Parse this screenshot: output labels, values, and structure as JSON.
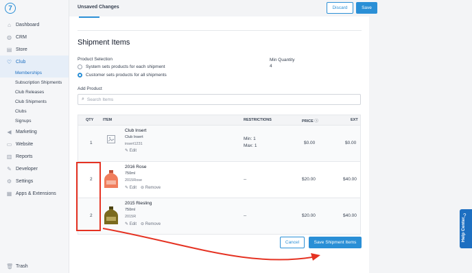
{
  "topbar": {
    "title": "Unsaved Changes",
    "discard_label": "Discard",
    "save_label": "Save"
  },
  "logo": "7",
  "sidebar": {
    "items": [
      {
        "label": "Dashboard",
        "icon": "home-icon"
      },
      {
        "label": "CRM",
        "icon": "crm-icon"
      },
      {
        "label": "Store",
        "icon": "store-icon"
      },
      {
        "label": "Club",
        "icon": "club-icon"
      },
      {
        "label": "Marketing",
        "icon": "megaphone-icon"
      },
      {
        "label": "Website",
        "icon": "monitor-icon"
      },
      {
        "label": "Reports",
        "icon": "chart-icon"
      },
      {
        "label": "Developer",
        "icon": "wrench-icon"
      },
      {
        "label": "Settings",
        "icon": "gear-icon"
      },
      {
        "label": "Apps & Extensions",
        "icon": "apps-icon"
      }
    ],
    "club_sub": [
      "Memberships",
      "Subscription Shipments",
      "Club Releases",
      "Club Shipments",
      "Clubs",
      "Signups"
    ],
    "trash": "Trash"
  },
  "main": {
    "title": "Shipment Items",
    "product_selection_label": "Product Selection",
    "option_1": "System sets products for each shipment",
    "option_2": "Customer sets products for all shipments",
    "min_quantity_label": "Min Quantity",
    "min_quantity_value": "4",
    "add_product_label": "Add Product",
    "search_placeholder": "Search Items",
    "cancel_label": "Cancel",
    "save_items_label": "Save Shipment Items"
  },
  "table": {
    "headers": {
      "qty": "QTY",
      "item": "ITEM",
      "restrictions": "RESTRICTIONS",
      "price": "PRICE",
      "ext": "EXT"
    },
    "rows": [
      {
        "qty": "1",
        "name": "Club Insert",
        "sub": "Club Insert",
        "sku": "insert1231",
        "restr_1": "Min: 1",
        "restr_2": "Max: 1",
        "price": "$0.00",
        "ext": "$0.00",
        "edit": "Edit"
      },
      {
        "qty": "2",
        "name": "2016 Rose",
        "sub": "750ml",
        "sku": "2015Rose",
        "restr": "--",
        "price": "$20.00",
        "ext": "$40.00",
        "edit": "Edit",
        "remove": "Remove"
      },
      {
        "qty": "2",
        "name": "2015 Riesling",
        "sub": "750ml",
        "sku": "2015R",
        "restr": "--",
        "price": "$20.00",
        "ext": "$40.00",
        "edit": "Edit",
        "remove": "Remove"
      }
    ]
  },
  "help_center": "Help Center",
  "colors": {
    "accent": "#2a8fd6",
    "annotation": "#e53222"
  }
}
